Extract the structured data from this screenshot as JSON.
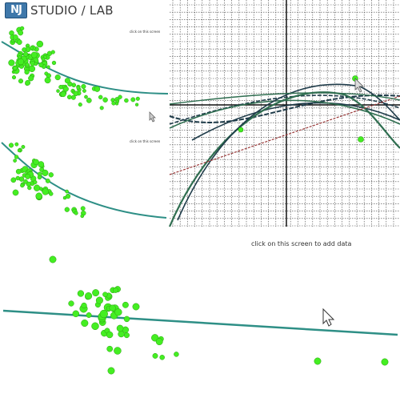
{
  "app": {
    "logo_badge": "NJ",
    "logo_text": "STUDIO / LAB"
  },
  "panels": {
    "instruction": "click on this screen to add data",
    "mini_label_1": "click on this screen",
    "mini_label_2": "click on this screen"
  },
  "colors": {
    "point": "#44ee22",
    "point_stroke": "#2aa010",
    "fit_line": "#2e8f86",
    "grid": "#444444",
    "axis": "#111111",
    "curve_dark": "#1f3c4a",
    "curve_green": "#2f6e50",
    "curve_red": "#9a3a3a"
  },
  "icons": {
    "cursor_main": "mouse-pointer-icon",
    "cursor_small": "mouse-pointer-icon",
    "cursor_grid": "mouse-pointer-icon"
  }
}
